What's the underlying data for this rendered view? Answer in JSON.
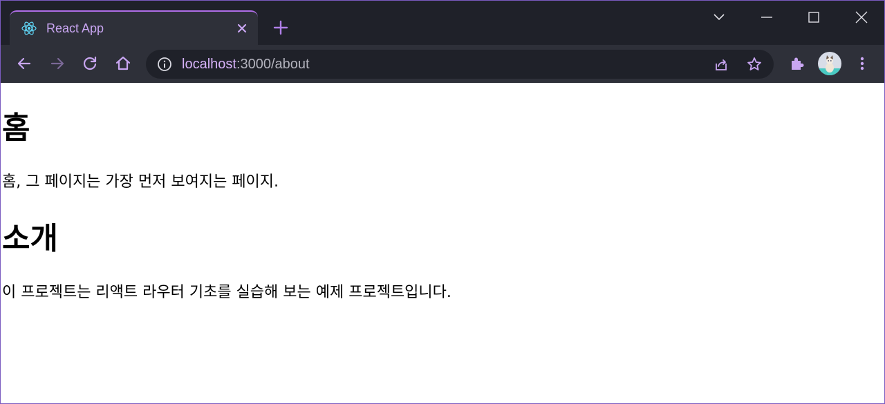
{
  "browser": {
    "tab": {
      "title": "React App"
    },
    "address_bar": {
      "host": "localhost",
      "path": ":3000/about"
    }
  },
  "page": {
    "sections": [
      {
        "heading": "홈",
        "text": "홈, 그 페이지는 가장 먼저 보여지는 페이지."
      },
      {
        "heading": "소개",
        "text": "이 프로젝트는 리액트 라우터 기초를 실습해 보는 예제 프로젝트입니다."
      }
    ]
  },
  "colors": {
    "accent": "#c9a6f2",
    "tab_strip": "#1f2129",
    "toolbar": "#2e3039",
    "omnibox": "#1f2129"
  },
  "icons": [
    "react-logo-icon",
    "close-icon",
    "plus-icon",
    "chevron-down-icon",
    "minimize-icon",
    "maximize-icon",
    "close-window-icon",
    "back-arrow-icon",
    "forward-arrow-icon",
    "reload-icon",
    "home-icon",
    "info-icon",
    "share-icon",
    "star-icon",
    "puzzle-icon",
    "more-vert-icon"
  ]
}
